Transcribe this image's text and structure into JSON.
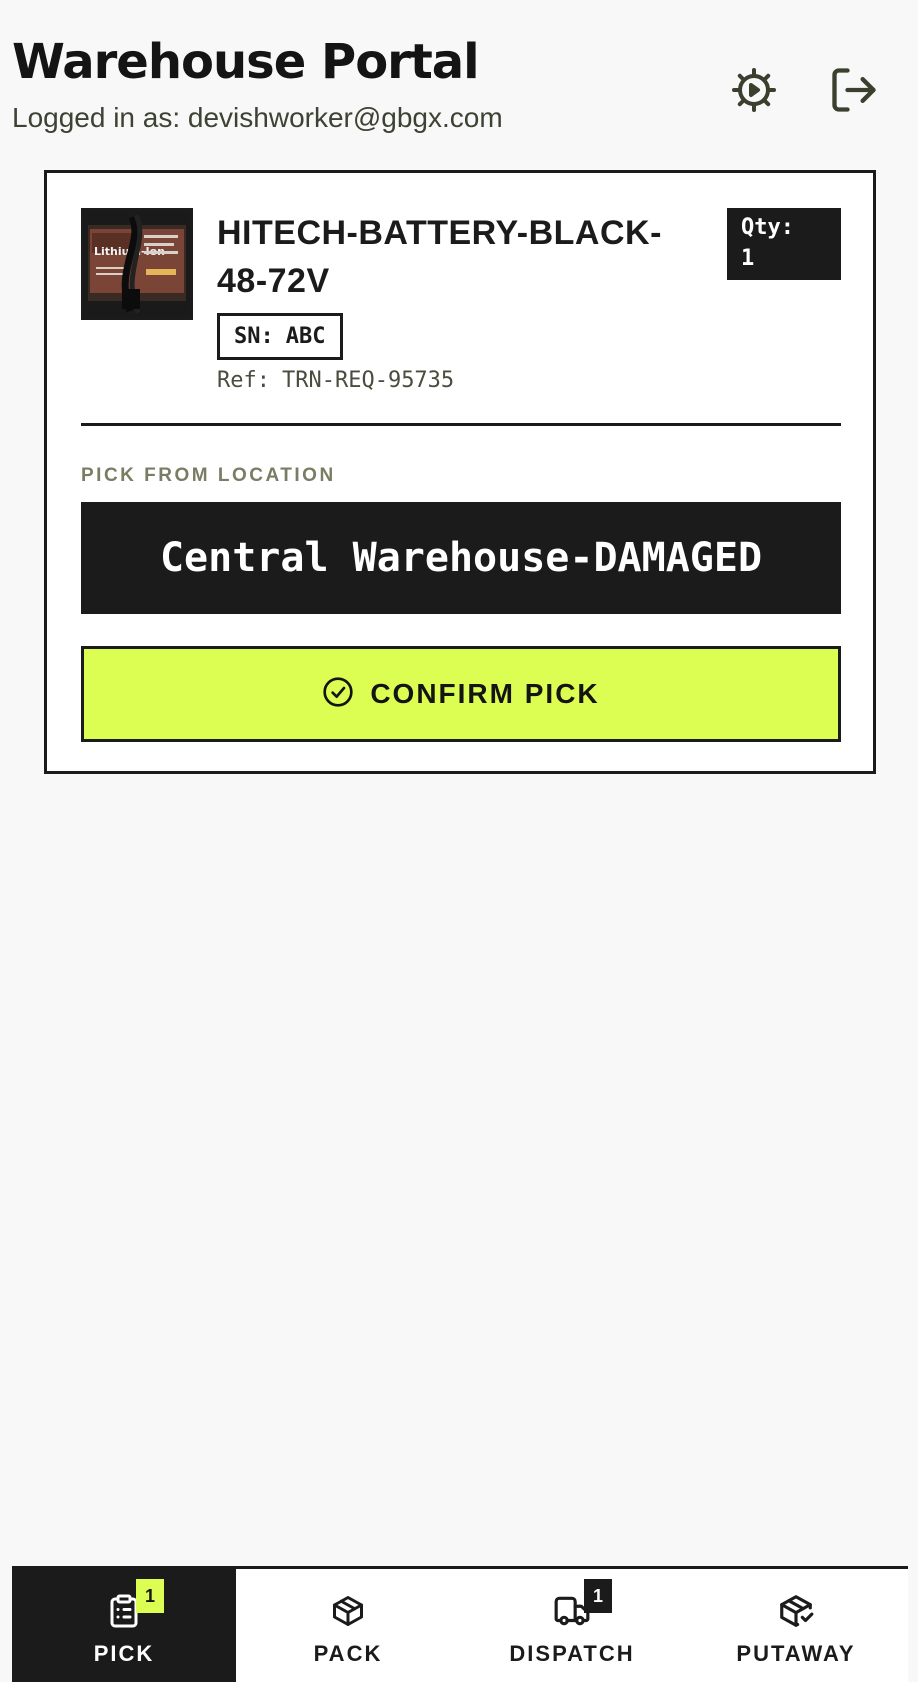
{
  "header": {
    "title": "Warehouse Portal",
    "subtitle": "Logged in as: devishworker@gbgx.com",
    "settings_icon": "settings-gear-icon",
    "logout_icon": "logout-icon"
  },
  "pick_card": {
    "product_name": "HITECH-BATTERY-BLACK-48-72V",
    "product_image_label": "Lithium-Ion",
    "qty_label": "Qty:",
    "qty_value": "1",
    "serial_label": "SN:",
    "serial_value": "ABC",
    "ref_label": "Ref:",
    "ref_value": "TRN-REQ-95735",
    "location_label": "PICK FROM LOCATION",
    "location_value": "Central Warehouse-DAMAGED",
    "confirm_label": "CONFIRM PICK",
    "confirm_icon": "check-circle-icon"
  },
  "bottom_nav": {
    "active": "PICK",
    "items": [
      {
        "label": "PICK",
        "icon": "clipboard-list-icon",
        "badge": "1"
      },
      {
        "label": "PACK",
        "icon": "package-icon",
        "badge": ""
      },
      {
        "label": "DISPATCH",
        "icon": "truck-icon",
        "badge": "1"
      },
      {
        "label": "PUTAWAY",
        "icon": "package-check-icon",
        "badge": ""
      }
    ]
  },
  "colors": {
    "accent_lime": "#dcfd52",
    "dark": "#1b1b1b",
    "background": "#f8f8f8",
    "muted_olive": "#7a7d63"
  }
}
